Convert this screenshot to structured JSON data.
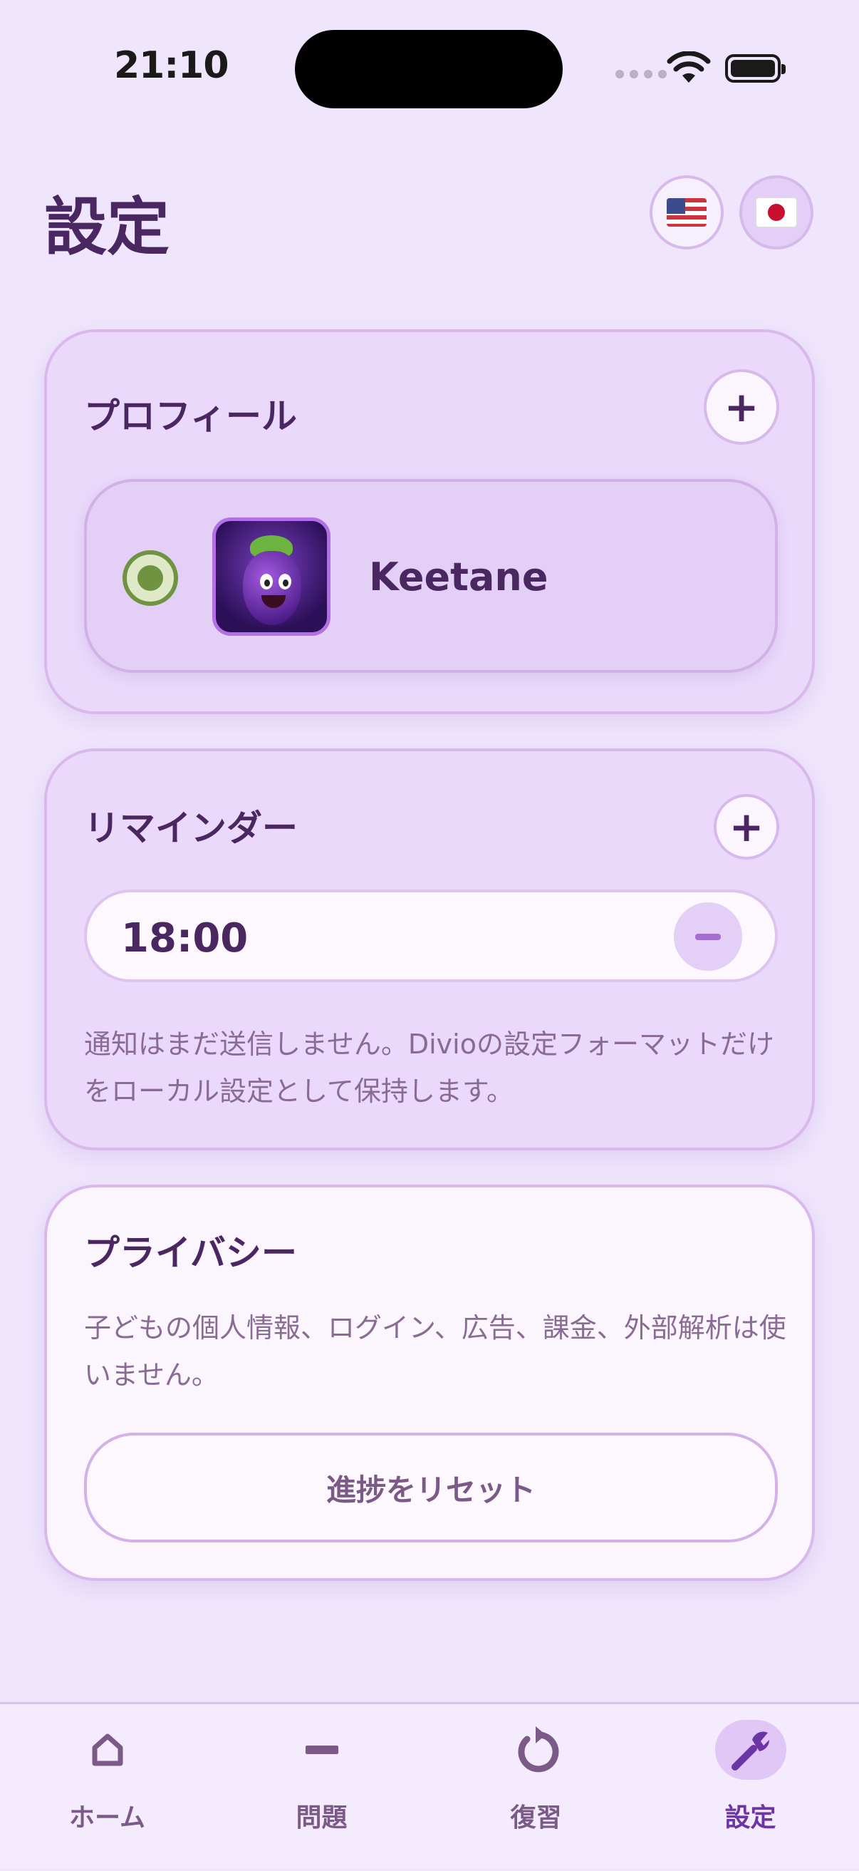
{
  "status_bar": {
    "time": "21:10"
  },
  "header": {
    "title": "設定",
    "languages": [
      {
        "code": "en",
        "icon": "us-flag-icon"
      },
      {
        "code": "ja",
        "icon": "japan-flag-icon",
        "selected": true
      }
    ]
  },
  "profile_section": {
    "title": "プロフィール",
    "add_icon": "+",
    "profiles": [
      {
        "name": "Keetane",
        "selected": true,
        "avatar": "eggplant-avatar"
      }
    ]
  },
  "reminder_section": {
    "title": "リマインダー",
    "add_icon": "+",
    "reminders": [
      {
        "time": "18:00"
      }
    ],
    "note": "通知はまだ送信しません。Divioの設定フォーマットだけをローカル設定として保持します。"
  },
  "privacy_section": {
    "title": "プライバシー",
    "note": "子どもの個人情報、ログイン、広告、課金、外部解析は使いません。",
    "reset_label": "進捗をリセット"
  },
  "tab_bar": {
    "items": [
      {
        "label": "ホーム",
        "icon": "home-icon"
      },
      {
        "label": "問題",
        "icon": "minus-icon"
      },
      {
        "label": "復習",
        "icon": "refresh-icon"
      },
      {
        "label": "設定",
        "icon": "wrench-icon",
        "active": true
      }
    ]
  },
  "colors": {
    "background": "#efe6fd",
    "text_primary": "#4a2760",
    "accent": "#6b35a6",
    "radio_green": "#6f9340"
  }
}
